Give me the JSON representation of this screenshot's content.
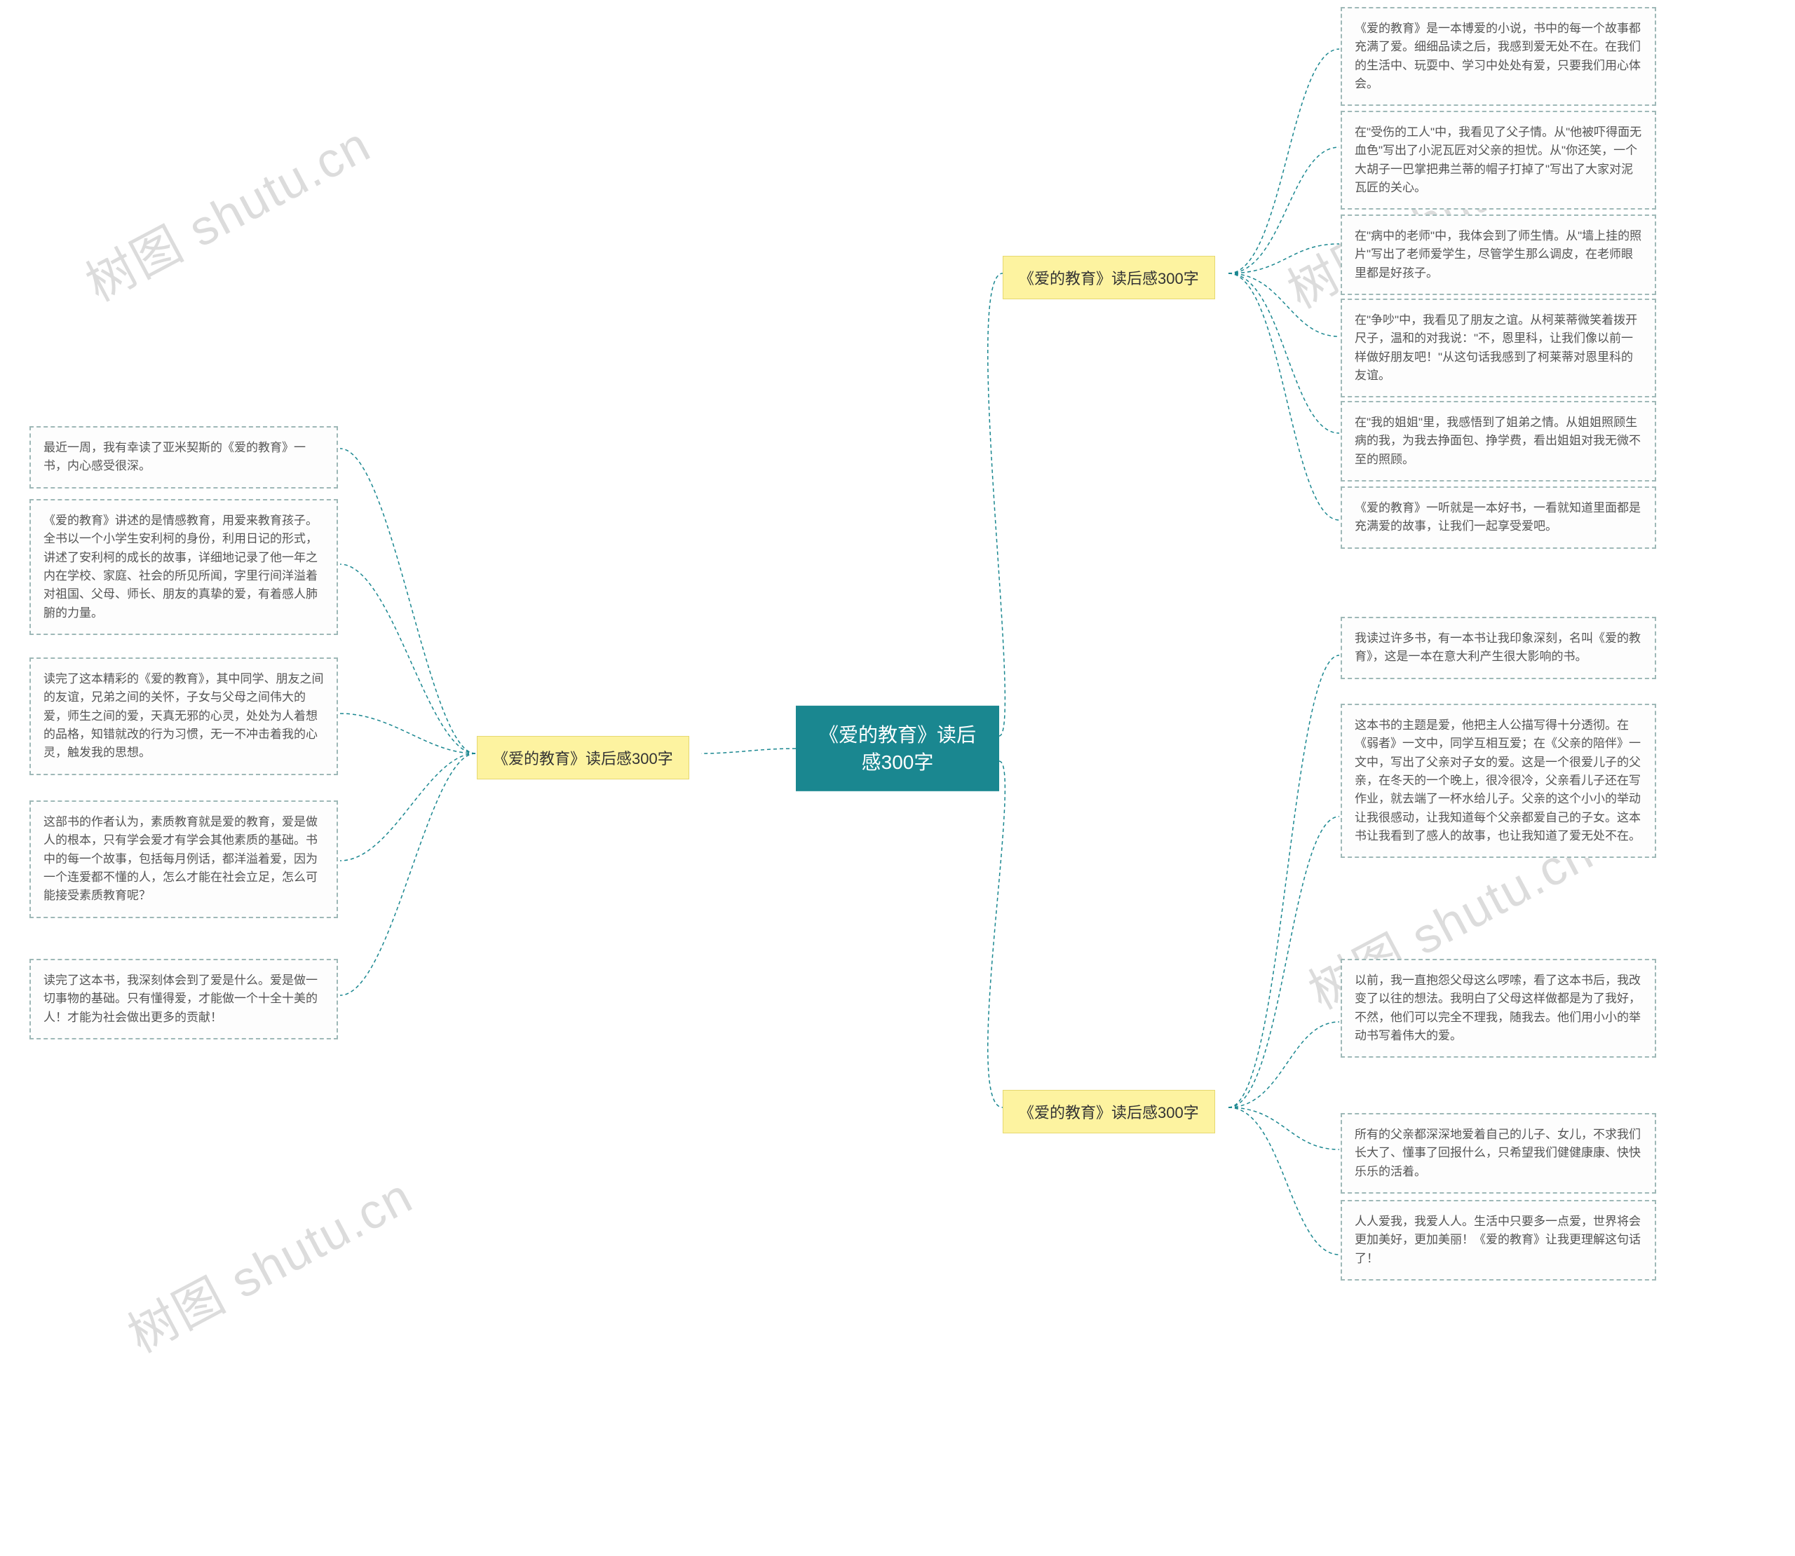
{
  "root": "《爱的教育》读后感300字",
  "watermark": "树图 shutu.cn",
  "branch_left": "《爱的教育》读后感300字",
  "branch_right_1": "《爱的教育》读后感300字",
  "branch_right_2": "《爱的教育》读后感300字",
  "left_leaves": [
    "最近一周，我有幸读了亚米契斯的《爱的教育》一书，内心感受很深。",
    "《爱的教育》讲述的是情感教育，用爱来教育孩子。全书以一个小学生安利柯的身份，利用日记的形式，讲述了安利柯的成长的故事，详细地记录了他一年之内在学校、家庭、社会的所见所闻，字里行间洋溢着对祖国、父母、师长、朋友的真挚的爱，有着感人肺腑的力量。",
    "读完了这本精彩的《爱的教育》，其中同学、朋友之间的友谊，兄弟之间的关怀，子女与父母之间伟大的爱，师生之间的爱，天真无邪的心灵，处处为人着想的品格，知错就改的行为习惯，无一不冲击着我的心灵，触发我的思想。",
    "这部书的作者认为，素质教育就是爱的教育，爱是做人的根本，只有学会爱才有学会其他素质的基础。书中的每一个故事，包括每月例话，都洋溢着爱，因为一个连爱都不懂的人，怎么才能在社会立足，怎么可能接受素质教育呢？",
    "读完了这本书，我深刻体会到了爱是什么。爱是做一切事物的基础。只有懂得爱，才能做一个十全十美的人！才能为社会做出更多的贡献！"
  ],
  "right1_leaves": [
    "《爱的教育》是一本博爱的小说，书中的每一个故事都充满了爱。细细品读之后，我感到爱无处不在。在我们的生活中、玩耍中、学习中处处有爱，只要我们用心体会。",
    "在\"受伤的工人\"中，我看见了父子情。从\"他被吓得面无血色\"写出了小泥瓦匠对父亲的担忧。从\"你还笑，一个大胡子一巴掌把弗兰蒂的帽子打掉了\"写出了大家对泥瓦匠的关心。",
    "在\"病中的老师\"中，我体会到了师生情。从\"墙上挂的照片\"写出了老师爱学生，尽管学生那么调皮，在老师眼里都是好孩子。",
    "在\"争吵\"中，我看见了朋友之谊。从柯莱蒂微笑着拨开尺子，温和的对我说：\"不，恩里科，让我们像以前一样做好朋友吧！\"从这句话我感到了柯莱蒂对恩里科的友谊。",
    "在\"我的姐姐\"里，我感悟到了姐弟之情。从姐姐照顾生病的我，为我去挣面包、挣学费，看出姐姐对我无微不至的照顾。",
    "《爱的教育》一听就是一本好书，一看就知道里面都是充满爱的故事，让我们一起享受爱吧。"
  ],
  "right2_leaves": [
    "我读过许多书，有一本书让我印象深刻，名叫《爱的教育》，这是一本在意大利产生很大影响的书。",
    "这本书的主题是爱，他把主人公描写得十分透彻。在《弱者》一文中，同学互相互爱；在《父亲的陪伴》一文中，写出了父亲对子女的爱。这是一个很爱儿子的父亲，在冬天的一个晚上，很冷很冷，父亲看儿子还在写作业，就去端了一杯水给儿子。父亲的这个小小的举动让我很感动，让我知道每个父亲都爱自己的子女。这本书让我看到了感人的故事，也让我知道了爱无处不在。",
    "以前，我一直抱怨父母这么啰嗦，看了这本书后，我改变了以往的想法。我明白了父母这样做都是为了我好，不然，他们可以完全不理我，随我去。他们用小小的举动书写着伟大的爱。",
    "所有的父亲都深深地爱着自己的儿子、女儿，不求我们长大了、懂事了回报什么，只希望我们健健康康、快快乐乐的活着。",
    "人人爱我，我爱人人。生活中只要多一点爱，世界将会更加美好，更加美丽！《爱的教育》让我更理解这句话了！"
  ]
}
